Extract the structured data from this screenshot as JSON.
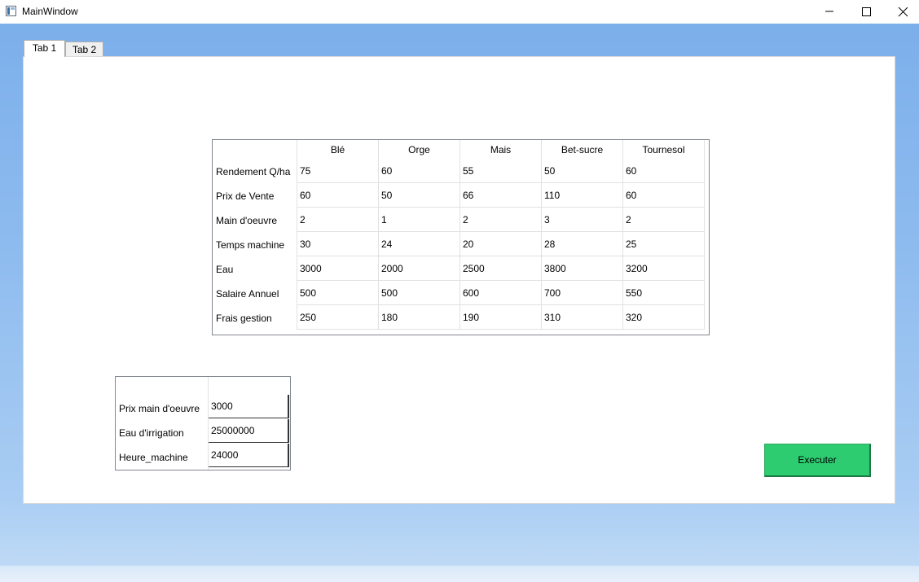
{
  "window": {
    "title": "MainWindow",
    "icons": {
      "app": "app-window-icon",
      "minimize": "minimize-icon",
      "maximize": "maximize-icon",
      "close": "close-icon"
    }
  },
  "tabs": [
    {
      "label": "Tab 1",
      "selected": true
    },
    {
      "label": "Tab 2",
      "selected": false
    }
  ],
  "table": {
    "columns": [
      "Blé",
      "Orge",
      "Mais",
      "Bet-sucre",
      "Tournesol"
    ],
    "rows": [
      {
        "label": "Rendement Q/ha",
        "values": [
          "75",
          "60",
          "55",
          "50",
          "60"
        ]
      },
      {
        "label": "Prix de Vente",
        "values": [
          "60",
          "50",
          "66",
          "110",
          "60"
        ]
      },
      {
        "label": "Main d'oeuvre",
        "values": [
          "2",
          "1",
          "2",
          "3",
          "2"
        ]
      },
      {
        "label": "Temps machine",
        "values": [
          "30",
          "24",
          "20",
          "28",
          "25"
        ]
      },
      {
        "label": "Eau",
        "values": [
          "3000",
          "2000",
          "2500",
          "3800",
          "3200"
        ]
      },
      {
        "label": "Salaire Annuel",
        "values": [
          "500",
          "500",
          "600",
          "700",
          "550"
        ]
      },
      {
        "label": "Frais gestion",
        "values": [
          "250",
          "180",
          "190",
          "310",
          "320"
        ]
      }
    ]
  },
  "params": [
    {
      "label": "Prix main d'oeuvre",
      "value": "3000"
    },
    {
      "label": "Eau d'irrigation",
      "value": "25000000"
    },
    {
      "label": "Heure_machine",
      "value": "24000"
    }
  ],
  "execute_button": {
    "label": "Executer",
    "color": "#2ecc71"
  },
  "colors": {
    "desktop": "#7aaeea",
    "panel": "#ffffff"
  }
}
